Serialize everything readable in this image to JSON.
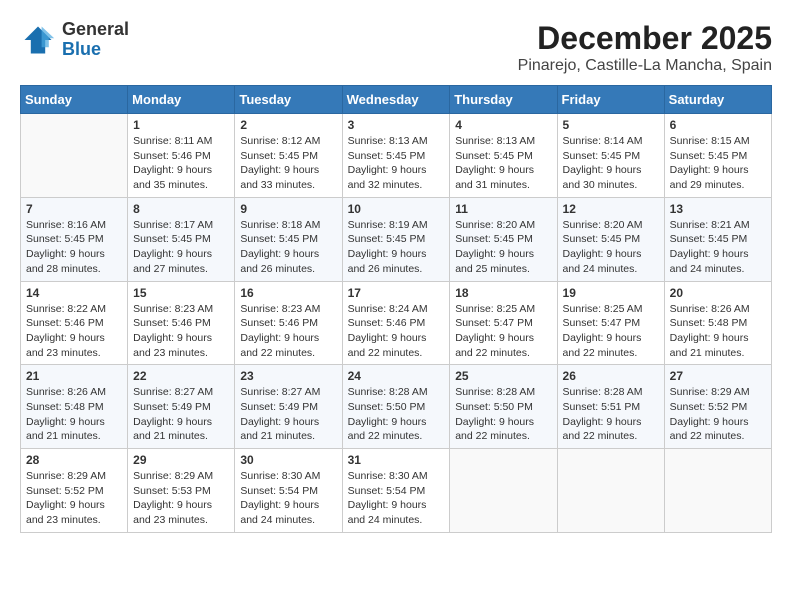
{
  "header": {
    "logo_line1": "General",
    "logo_line2": "Blue",
    "title": "December 2025",
    "subtitle": "Pinarejo, Castille-La Mancha, Spain"
  },
  "weekdays": [
    "Sunday",
    "Monday",
    "Tuesday",
    "Wednesday",
    "Thursday",
    "Friday",
    "Saturday"
  ],
  "weeks": [
    [
      {
        "day": "",
        "sunrise": "",
        "sunset": "",
        "daylight": ""
      },
      {
        "day": "1",
        "sunrise": "Sunrise: 8:11 AM",
        "sunset": "Sunset: 5:46 PM",
        "daylight": "Daylight: 9 hours and 35 minutes."
      },
      {
        "day": "2",
        "sunrise": "Sunrise: 8:12 AM",
        "sunset": "Sunset: 5:45 PM",
        "daylight": "Daylight: 9 hours and 33 minutes."
      },
      {
        "day": "3",
        "sunrise": "Sunrise: 8:13 AM",
        "sunset": "Sunset: 5:45 PM",
        "daylight": "Daylight: 9 hours and 32 minutes."
      },
      {
        "day": "4",
        "sunrise": "Sunrise: 8:13 AM",
        "sunset": "Sunset: 5:45 PM",
        "daylight": "Daylight: 9 hours and 31 minutes."
      },
      {
        "day": "5",
        "sunrise": "Sunrise: 8:14 AM",
        "sunset": "Sunset: 5:45 PM",
        "daylight": "Daylight: 9 hours and 30 minutes."
      },
      {
        "day": "6",
        "sunrise": "Sunrise: 8:15 AM",
        "sunset": "Sunset: 5:45 PM",
        "daylight": "Daylight: 9 hours and 29 minutes."
      }
    ],
    [
      {
        "day": "7",
        "sunrise": "Sunrise: 8:16 AM",
        "sunset": "Sunset: 5:45 PM",
        "daylight": "Daylight: 9 hours and 28 minutes."
      },
      {
        "day": "8",
        "sunrise": "Sunrise: 8:17 AM",
        "sunset": "Sunset: 5:45 PM",
        "daylight": "Daylight: 9 hours and 27 minutes."
      },
      {
        "day": "9",
        "sunrise": "Sunrise: 8:18 AM",
        "sunset": "Sunset: 5:45 PM",
        "daylight": "Daylight: 9 hours and 26 minutes."
      },
      {
        "day": "10",
        "sunrise": "Sunrise: 8:19 AM",
        "sunset": "Sunset: 5:45 PM",
        "daylight": "Daylight: 9 hours and 26 minutes."
      },
      {
        "day": "11",
        "sunrise": "Sunrise: 8:20 AM",
        "sunset": "Sunset: 5:45 PM",
        "daylight": "Daylight: 9 hours and 25 minutes."
      },
      {
        "day": "12",
        "sunrise": "Sunrise: 8:20 AM",
        "sunset": "Sunset: 5:45 PM",
        "daylight": "Daylight: 9 hours and 24 minutes."
      },
      {
        "day": "13",
        "sunrise": "Sunrise: 8:21 AM",
        "sunset": "Sunset: 5:45 PM",
        "daylight": "Daylight: 9 hours and 24 minutes."
      }
    ],
    [
      {
        "day": "14",
        "sunrise": "Sunrise: 8:22 AM",
        "sunset": "Sunset: 5:46 PM",
        "daylight": "Daylight: 9 hours and 23 minutes."
      },
      {
        "day": "15",
        "sunrise": "Sunrise: 8:23 AM",
        "sunset": "Sunset: 5:46 PM",
        "daylight": "Daylight: 9 hours and 23 minutes."
      },
      {
        "day": "16",
        "sunrise": "Sunrise: 8:23 AM",
        "sunset": "Sunset: 5:46 PM",
        "daylight": "Daylight: 9 hours and 22 minutes."
      },
      {
        "day": "17",
        "sunrise": "Sunrise: 8:24 AM",
        "sunset": "Sunset: 5:46 PM",
        "daylight": "Daylight: 9 hours and 22 minutes."
      },
      {
        "day": "18",
        "sunrise": "Sunrise: 8:25 AM",
        "sunset": "Sunset: 5:47 PM",
        "daylight": "Daylight: 9 hours and 22 minutes."
      },
      {
        "day": "19",
        "sunrise": "Sunrise: 8:25 AM",
        "sunset": "Sunset: 5:47 PM",
        "daylight": "Daylight: 9 hours and 22 minutes."
      },
      {
        "day": "20",
        "sunrise": "Sunrise: 8:26 AM",
        "sunset": "Sunset: 5:48 PM",
        "daylight": "Daylight: 9 hours and 21 minutes."
      }
    ],
    [
      {
        "day": "21",
        "sunrise": "Sunrise: 8:26 AM",
        "sunset": "Sunset: 5:48 PM",
        "daylight": "Daylight: 9 hours and 21 minutes."
      },
      {
        "day": "22",
        "sunrise": "Sunrise: 8:27 AM",
        "sunset": "Sunset: 5:49 PM",
        "daylight": "Daylight: 9 hours and 21 minutes."
      },
      {
        "day": "23",
        "sunrise": "Sunrise: 8:27 AM",
        "sunset": "Sunset: 5:49 PM",
        "daylight": "Daylight: 9 hours and 21 minutes."
      },
      {
        "day": "24",
        "sunrise": "Sunrise: 8:28 AM",
        "sunset": "Sunset: 5:50 PM",
        "daylight": "Daylight: 9 hours and 22 minutes."
      },
      {
        "day": "25",
        "sunrise": "Sunrise: 8:28 AM",
        "sunset": "Sunset: 5:50 PM",
        "daylight": "Daylight: 9 hours and 22 minutes."
      },
      {
        "day": "26",
        "sunrise": "Sunrise: 8:28 AM",
        "sunset": "Sunset: 5:51 PM",
        "daylight": "Daylight: 9 hours and 22 minutes."
      },
      {
        "day": "27",
        "sunrise": "Sunrise: 8:29 AM",
        "sunset": "Sunset: 5:52 PM",
        "daylight": "Daylight: 9 hours and 22 minutes."
      }
    ],
    [
      {
        "day": "28",
        "sunrise": "Sunrise: 8:29 AM",
        "sunset": "Sunset: 5:52 PM",
        "daylight": "Daylight: 9 hours and 23 minutes."
      },
      {
        "day": "29",
        "sunrise": "Sunrise: 8:29 AM",
        "sunset": "Sunset: 5:53 PM",
        "daylight": "Daylight: 9 hours and 23 minutes."
      },
      {
        "day": "30",
        "sunrise": "Sunrise: 8:30 AM",
        "sunset": "Sunset: 5:54 PM",
        "daylight": "Daylight: 9 hours and 24 minutes."
      },
      {
        "day": "31",
        "sunrise": "Sunrise: 8:30 AM",
        "sunset": "Sunset: 5:54 PM",
        "daylight": "Daylight: 9 hours and 24 minutes."
      },
      {
        "day": "",
        "sunrise": "",
        "sunset": "",
        "daylight": ""
      },
      {
        "day": "",
        "sunrise": "",
        "sunset": "",
        "daylight": ""
      },
      {
        "day": "",
        "sunrise": "",
        "sunset": "",
        "daylight": ""
      }
    ]
  ]
}
